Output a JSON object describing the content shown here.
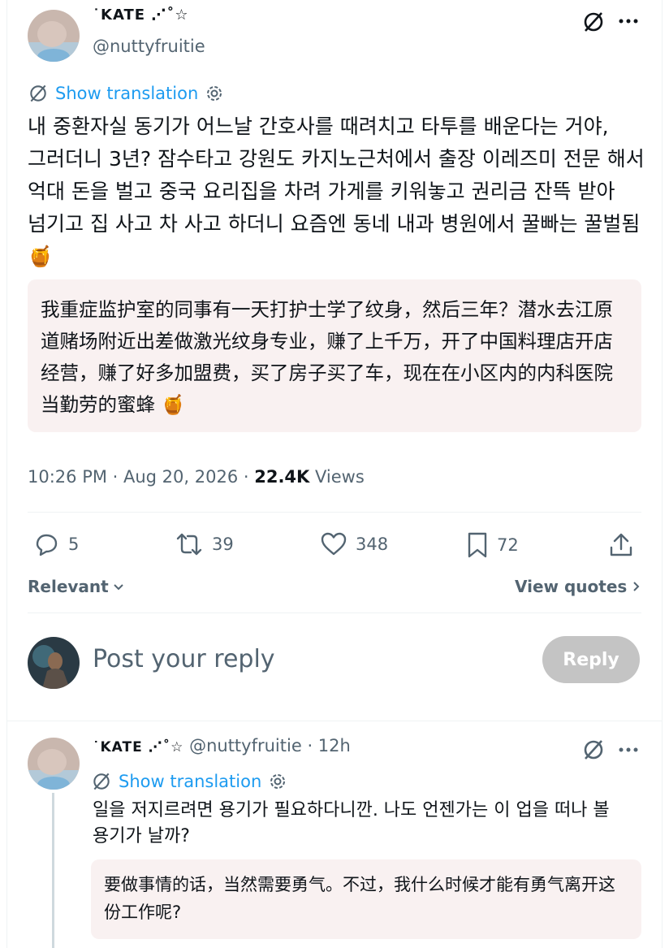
{
  "tweet": {
    "display_name": "˙KATE ⋰˚☆",
    "handle": "@nuttyfruitie",
    "show_translation": "Show translation",
    "text": "내 중환자실 동기가 어느날 간호사를 때려치고 타투를 배운다는 거야, 그러더니 3년? 잠수타고 강원도 카지노근처에서 출장 이레즈미 전문 해서 억대 돈을 벌고 중국 요리집을 차려 가게를 키워놓고 권리금 잔뜩 받아 넘기고 집 사고 차 사고 하더니 요즘엔 동네 내과 병원에서 꿀빠는 꿀벌됨 🍯",
    "translation": "我重症监护室的同事有一天打护士学了纹身，然后三年？潜水去江原道赌场附近出差做激光纹身专业，赚了上千万，开了中国料理店开店经营，赚了好多加盟费，买了房子买了车，现在在小区内的内科医院当勤劳的蜜蜂 🍯",
    "time": "10:26 PM · Aug 20, 2026 · ",
    "views_count": "22.4K",
    "views_label": " Views"
  },
  "stats": {
    "replies": "5",
    "retweets": "39",
    "likes": "348",
    "bookmarks": "72"
  },
  "sort": {
    "relevant": "Relevant",
    "view_quotes": "View quotes"
  },
  "composer": {
    "placeholder": "Post your reply",
    "reply_button": "Reply"
  },
  "reply": {
    "display_name": "˙KATE ⋰˚☆",
    "handle": "@nuttyfruitie",
    "dot": " · ",
    "time": "12h",
    "show_translation": "Show translation",
    "text": "일을 저지르려면 용기가 필요하다니깐. 나도 언젠가는 이 업을 떠나 볼 용기가 날까?",
    "translation": "要做事情的话，当然需要勇气。不过，我什么时候才能有勇气离开这份工作呢?"
  },
  "colors": {
    "accent": "#1d9bf0",
    "muted": "#536471",
    "translation_bg": "#f9f1f1",
    "reply_button_bg": "#c4c4c4"
  }
}
